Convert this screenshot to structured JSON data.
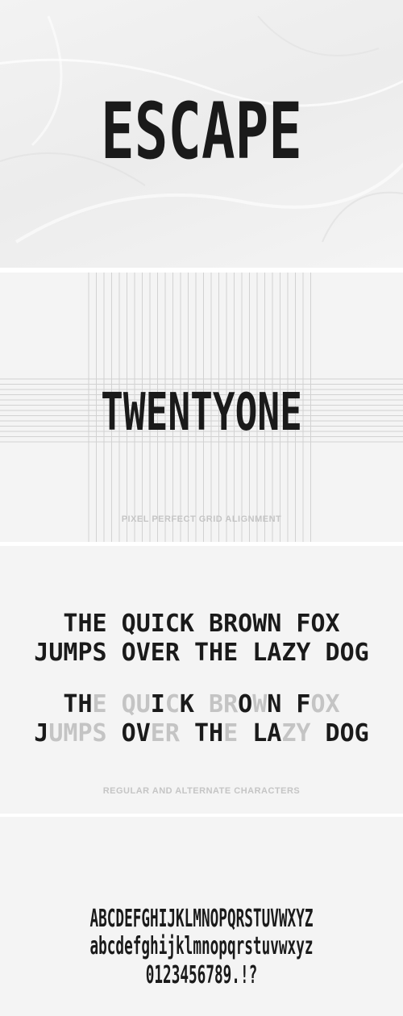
{
  "hero": {
    "title": "ESCAPE"
  },
  "grid_panel": {
    "word": "TWENTYONE",
    "caption": "PIXEL PERFECT GRID ALIGNMENT"
  },
  "pangram_panel": {
    "regular_lines": [
      "THE QUICK BROWN FOX",
      "JUMPS OVER THE LAZY DOG"
    ],
    "alternate_lines": [
      [
        {
          "t": "TH",
          "g": false
        },
        {
          "t": "E ",
          "g": true
        },
        {
          "t": "QU",
          "g": true
        },
        {
          "t": "I",
          "g": false
        },
        {
          "t": "C",
          "g": true
        },
        {
          "t": "K ",
          "g": false
        },
        {
          "t": "BR",
          "g": true
        },
        {
          "t": "O",
          "g": false
        },
        {
          "t": "W",
          "g": true
        },
        {
          "t": "N ",
          "g": false
        },
        {
          "t": "F",
          "g": false
        },
        {
          "t": "O",
          "g": true
        },
        {
          "t": "X",
          "g": true
        }
      ],
      [
        {
          "t": "J",
          "g": false
        },
        {
          "t": "UMPS ",
          "g": true
        },
        {
          "t": "OV",
          "g": false
        },
        {
          "t": "ER ",
          "g": true
        },
        {
          "t": "TH",
          "g": false
        },
        {
          "t": "E ",
          "g": true
        },
        {
          "t": "LA",
          "g": false
        },
        {
          "t": "ZY",
          "g": true
        },
        {
          "t": " DOG",
          "g": false
        }
      ]
    ],
    "caption": "REGULAR AND ALTERNATE CHARACTERS"
  },
  "charset_panel": {
    "uppercase": "ABCDEFGHIJKLMNOPQRSTUVWXYZ",
    "lowercase": "abcdefghijklmnopqrstuvwxyz",
    "numerals": "0123456789.!?"
  },
  "colors": {
    "ink": "#1a1a1a",
    "alternate_grey": "#c4c4c4",
    "caption_grey": "#c5c5c5",
    "panel_bg": "#f4f4f4",
    "grid_line": "#d2d2d2"
  }
}
